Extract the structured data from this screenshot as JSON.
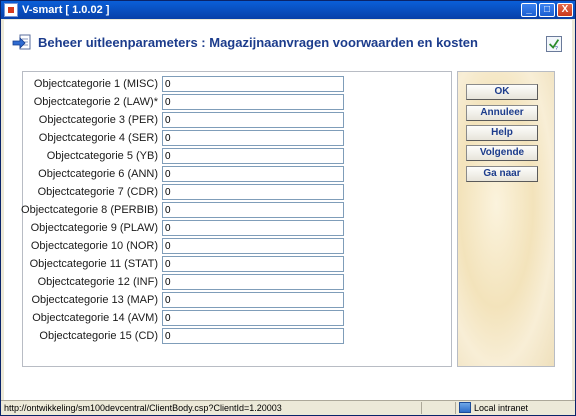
{
  "window": {
    "title": "V-smart [ 1.0.02 ]",
    "buttons": {
      "minimize": "_",
      "maximize": "□",
      "close": "X"
    }
  },
  "header": {
    "title": "Beheer uitleenparameters : Magazijnaanvragen voorwaarden en kosten",
    "icon": "arrow-document-icon",
    "help_icon": "checkmark-help-icon"
  },
  "form": {
    "rows": [
      {
        "label": "Objectcategorie 1 (MISC)",
        "value": "0"
      },
      {
        "label": "Objectcategorie 2 (LAW)*",
        "value": "0"
      },
      {
        "label": "Objectcategorie 3 (PER)",
        "value": "0"
      },
      {
        "label": "Objectcategorie 4 (SER)",
        "value": "0"
      },
      {
        "label": "Objectcategorie 5 (YB)",
        "value": "0"
      },
      {
        "label": "Objectcategorie 6 (ANN)",
        "value": "0"
      },
      {
        "label": "Objectcategorie 7 (CDR)",
        "value": "0"
      },
      {
        "label": "Objectcategorie 8 (PERBIB)",
        "value": "0"
      },
      {
        "label": "Objectcategorie 9 (PLAW)",
        "value": "0"
      },
      {
        "label": "Objectcategorie 10 (NOR)",
        "value": "0"
      },
      {
        "label": "Objectcategorie 11 (STAT)",
        "value": "0"
      },
      {
        "label": "Objectcategorie 12 (INF)",
        "value": "0"
      },
      {
        "label": "Objectcategorie 13 (MAP)",
        "value": "0"
      },
      {
        "label": "Objectcategorie 14 (AVM)",
        "value": "0"
      },
      {
        "label": "Objectcategorie 15 (CD)",
        "value": "0"
      }
    ]
  },
  "actions": {
    "ok": "OK",
    "annuleer": "Annuleer",
    "help": "Help",
    "volgende": "Volgende",
    "ga_naar": "Ga naar"
  },
  "statusbar": {
    "url": "http://ontwikkeling/sm100devcentral/ClientBody.csp?ClientId=1.20003",
    "zone": "Local intranet"
  }
}
